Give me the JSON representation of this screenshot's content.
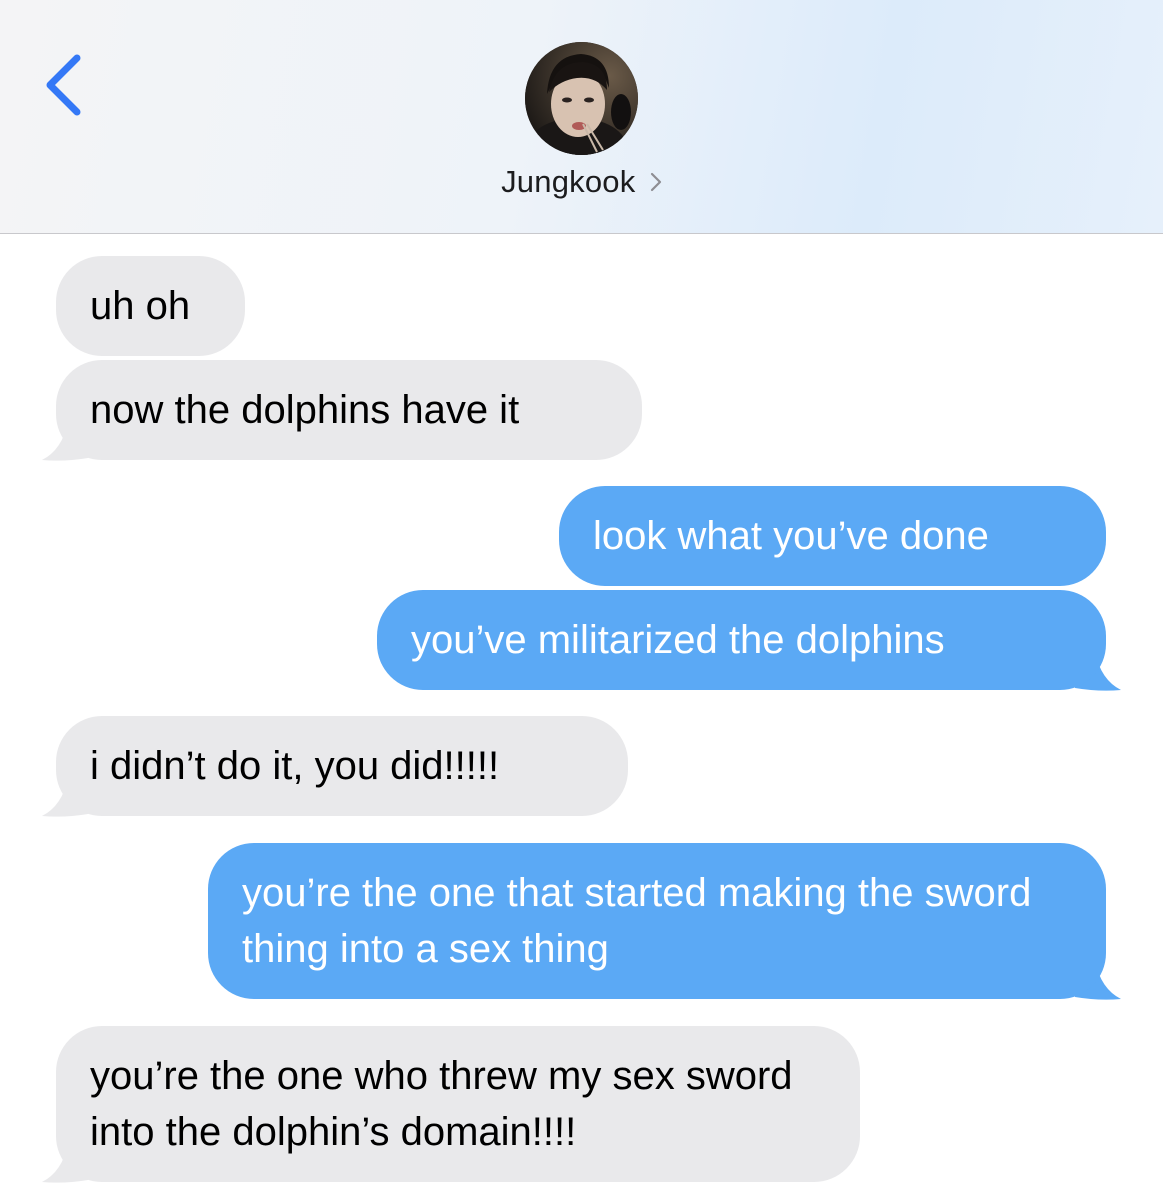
{
  "header": {
    "back_icon": "chevron-left-icon",
    "contact_name": "Jungkook",
    "contact_chevron_icon": "chevron-right-icon"
  },
  "colors": {
    "accent": "#3478f6",
    "incoming_bubble": "#e9e9eb",
    "outgoing_bubble": "#5ba9f5"
  },
  "messages": [
    {
      "direction": "incoming",
      "text": "uh oh"
    },
    {
      "direction": "incoming",
      "text": "now the dolphins have it"
    },
    {
      "direction": "outgoing",
      "text": "look what you’ve done"
    },
    {
      "direction": "outgoing",
      "text": "you’ve militarized the dolphins"
    },
    {
      "direction": "incoming",
      "text": "i didn’t do it, you did!!!!!"
    },
    {
      "direction": "outgoing",
      "text": "you’re the one that started making the sword thing into a sex thing"
    },
    {
      "direction": "incoming",
      "text": "you’re the one who threw my sex sword into the dolphin’s domain!!!!"
    }
  ]
}
